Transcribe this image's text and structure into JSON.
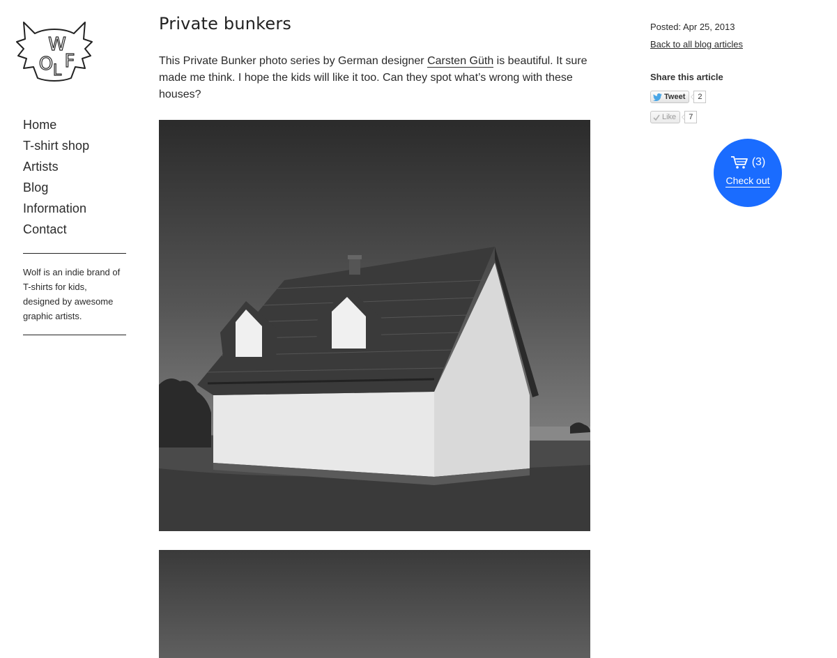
{
  "brand": {
    "logo_letters": "WOLF",
    "blurb": "Wolf is an indie brand of T-shirts for kids, designed by awesome graphic artists."
  },
  "nav": {
    "items": [
      {
        "label": "Home"
      },
      {
        "label": "T-shirt shop"
      },
      {
        "label": "Artists"
      },
      {
        "label": "Blog"
      },
      {
        "label": "Information"
      },
      {
        "label": "Contact"
      }
    ]
  },
  "article": {
    "title": "Private bunkers",
    "body_before_link": "This Private Bunker photo series by German designer ",
    "designer_link": "Carsten Güth",
    "body_after_link": " is beautiful. It sure made me think. I hope the kids will like it too. Can they spot what’s wrong with these houses?"
  },
  "sidebar": {
    "posted": "Posted: Apr 25, 2013",
    "back_link": "Back to all blog articles",
    "share_heading": "Share this article",
    "tweet_label": "Tweet",
    "tweet_count": "2",
    "like_label": "Like",
    "like_count": "7"
  },
  "cart": {
    "count": "(3)",
    "label": "Check out"
  },
  "colors": {
    "accent": "#1a6cff",
    "text": "#2a2a2a"
  },
  "icons": [
    "wolf-logo",
    "twitter-bird-icon",
    "like-check-icon",
    "cart-icon"
  ]
}
